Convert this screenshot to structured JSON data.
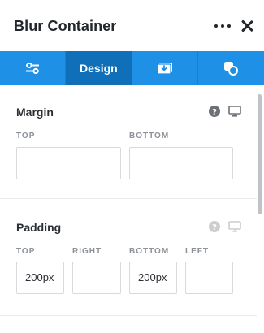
{
  "header": {
    "title": "Blur Container",
    "more_icon": "more-horizontal-icon",
    "close_icon": "close-icon"
  },
  "tabs": [
    {
      "label": "",
      "icon": "sliders-icon",
      "active": false
    },
    {
      "label": "Design",
      "icon": "",
      "active": true
    },
    {
      "label": "",
      "icon": "media-download-icon",
      "active": false
    },
    {
      "label": "",
      "icon": "shapes-icon",
      "active": false
    }
  ],
  "margin": {
    "title": "Margin",
    "fields": [
      {
        "label": "TOP",
        "value": ""
      },
      {
        "label": "BOTTOM",
        "value": ""
      }
    ]
  },
  "padding": {
    "title": "Padding",
    "fields": [
      {
        "label": "TOP",
        "value": "200px"
      },
      {
        "label": "RIGHT",
        "value": ""
      },
      {
        "label": "BOTTOM",
        "value": "200px"
      },
      {
        "label": "LEFT",
        "value": ""
      }
    ]
  },
  "colors": {
    "tab_bar": "#1e90e6",
    "tab_active": "#0f6fb8"
  }
}
